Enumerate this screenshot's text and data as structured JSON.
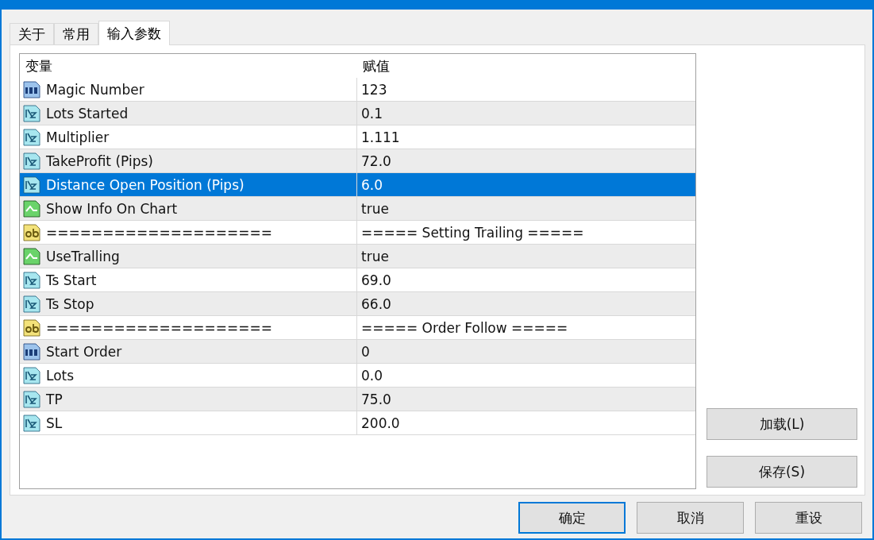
{
  "tabs": [
    {
      "label": "关于",
      "selected": false
    },
    {
      "label": "常用",
      "selected": false
    },
    {
      "label": "输入参数",
      "selected": true
    }
  ],
  "table": {
    "columns": [
      "变量",
      "赋值"
    ],
    "rows": [
      {
        "kind": "int",
        "name": "Magic Number",
        "value": "123",
        "selected": false
      },
      {
        "kind": "double",
        "name": "Lots Started",
        "value": "0.1",
        "selected": false
      },
      {
        "kind": "double",
        "name": "Multiplier",
        "value": "1.111",
        "selected": false
      },
      {
        "kind": "double",
        "name": "TakeProfit (Pips)",
        "value": "72.0",
        "selected": false
      },
      {
        "kind": "double",
        "name": "Distance Open Position (Pips)",
        "value": "6.0",
        "selected": true
      },
      {
        "kind": "bool",
        "name": "Show Info On Chart",
        "value": "true",
        "selected": false
      },
      {
        "kind": "string",
        "name": "====================",
        "value": "===== Setting Trailing =====",
        "selected": false
      },
      {
        "kind": "bool",
        "name": "UseTralling",
        "value": "true",
        "selected": false
      },
      {
        "kind": "double",
        "name": "Ts Start",
        "value": "69.0",
        "selected": false
      },
      {
        "kind": "double",
        "name": "Ts Stop",
        "value": "66.0",
        "selected": false
      },
      {
        "kind": "string",
        "name": "====================",
        "value": "===== Order Follow =====",
        "selected": false
      },
      {
        "kind": "int",
        "name": "Start Order",
        "value": "0",
        "selected": false
      },
      {
        "kind": "double",
        "name": "Lots",
        "value": "0.0",
        "selected": false
      },
      {
        "kind": "double",
        "name": "TP",
        "value": "75.0",
        "selected": false
      },
      {
        "kind": "double",
        "name": "SL",
        "value": "200.0",
        "selected": false
      }
    ]
  },
  "side_buttons": [
    "加载(L)",
    "保存(S)"
  ],
  "footer_buttons": [
    {
      "label": "确定",
      "default": true
    },
    {
      "label": "取消",
      "default": false
    },
    {
      "label": "重设",
      "default": false
    }
  ]
}
